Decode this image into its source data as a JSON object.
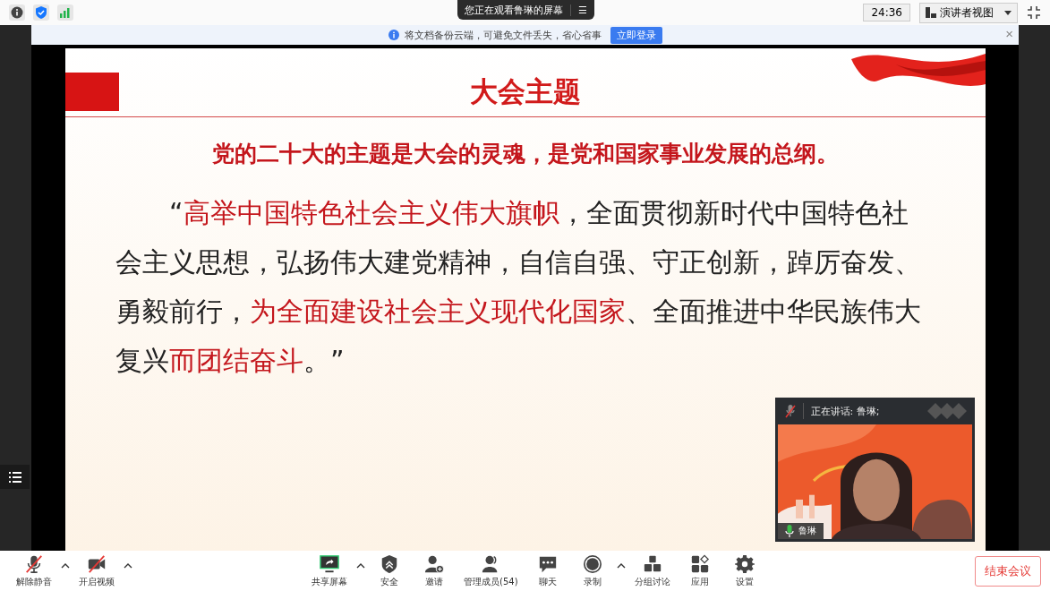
{
  "top_bar": {
    "viewing_label": "您正在观看鲁琳的屏幕",
    "view_menu_icon": "☰",
    "timer": "24:36",
    "view_mode": "演讲者视图"
  },
  "notice": {
    "text": "将文档备份云端，可避免文件丢失，省心省事",
    "button": "立即登录",
    "close": "×"
  },
  "slide": {
    "title": "大会主题",
    "subtitle": "党的二十大的主题是大会的灵魂，是党和国家事业发展的总纲。",
    "quote": [
      {
        "text": "“",
        "highlight": false
      },
      {
        "text": "高举中国特色社会主义伟大旗帜",
        "highlight": true
      },
      {
        "text": "，全面贯彻新时代中国特色社会主义思想，弘扬伟大建党精神，自信自强、守正创新，踔厉奋发、勇毅前行，",
        "highlight": false
      },
      {
        "text": "为全面建设社会主义现代化国家",
        "highlight": true
      },
      {
        "text": "、全面推进中华民族伟大复兴",
        "highlight": false
      },
      {
        "text": "而团结奋斗",
        "highlight": true
      },
      {
        "text": "。”",
        "highlight": false
      }
    ]
  },
  "speaker_tile": {
    "speaking_label": "正在讲话: 鲁琳;",
    "speaker_muted": true,
    "name": "鲁琳",
    "kind": "picture"
  },
  "toolbar": {
    "items": [
      {
        "label": "解除静音",
        "kind": "mic",
        "off": true,
        "has_menu": true
      },
      {
        "label": "开启视频",
        "kind": "camera",
        "off": true,
        "has_menu": true
      },
      {
        "label": "共享屏幕",
        "kind": "share",
        "off": false,
        "has_menu": true
      },
      {
        "label": "安全",
        "kind": "shield",
        "off": false,
        "has_menu": false
      },
      {
        "label": "邀请",
        "kind": "invite",
        "off": false,
        "has_menu": false
      },
      {
        "label": "管理成员(54)",
        "kind": "members",
        "off": false,
        "has_menu": false
      },
      {
        "label": "聊天",
        "kind": "chat",
        "off": false,
        "has_menu": false
      },
      {
        "label": "录制",
        "kind": "record",
        "off": false,
        "has_menu": true
      },
      {
        "label": "分组讨论",
        "kind": "breakout",
        "off": false,
        "has_menu": false
      },
      {
        "label": "应用",
        "kind": "apps",
        "off": false,
        "has_menu": false
      },
      {
        "label": "设置",
        "kind": "settings",
        "off": false,
        "has_menu": false
      }
    ],
    "end_button": "结束会议"
  }
}
